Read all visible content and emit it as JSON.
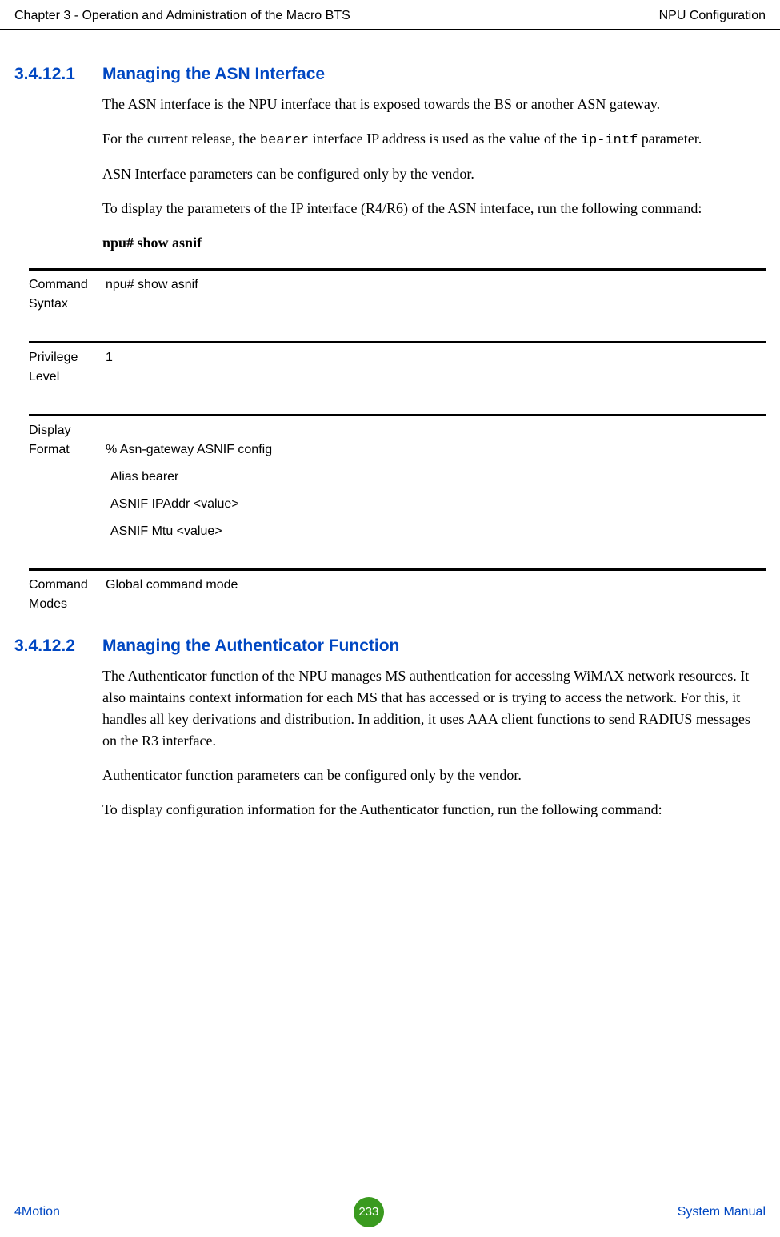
{
  "header": {
    "left": "Chapter 3 - Operation and Administration of the Macro BTS",
    "right": "NPU Configuration"
  },
  "section1": {
    "num": "3.4.12.1",
    "title": "Managing the ASN Interface",
    "p1a": "The ASN interface is the NPU interface that is exposed towards the BS or another ASN gateway.",
    "p2_prefix": "For the current release, the ",
    "p2_code1": "bearer",
    "p2_mid": " interface IP address is used as the value of the ",
    "p2_code2": "ip-intf",
    "p2_suffix": " parameter.",
    "p3": "ASN Interface parameters can be configured only by the vendor.",
    "p4": "To display the parameters of the IP interface (R4/R6) of the ASN interface, run the following command:",
    "cmd": "npu# show asnif"
  },
  "defs": {
    "syntax_label": "Command Syntax",
    "syntax_value": "npu# show asnif",
    "priv_label": "Privilege Level",
    "priv_value": "1",
    "display_label": "Display Format",
    "display_lines": {
      "l1": "% Asn-gateway ASNIF config",
      "l2": "Alias bearer",
      "l3": "ASNIF IPAddr <value>",
      "l4": "ASNIF Mtu <value>"
    },
    "modes_label": "Command Modes",
    "modes_value": "Global command mode"
  },
  "section2": {
    "num": "3.4.12.2",
    "title": "Managing the Authenticator Function",
    "p1": "The Authenticator function of the NPU manages MS authentication for accessing WiMAX network resources. It also maintains context information for each MS that has accessed or is trying to access the network. For this, it handles all key derivations and distribution. In addition, it uses AAA client functions to send RADIUS messages on the R3 interface.",
    "p2": "Authenticator function parameters can be configured only by the vendor.",
    "p3": "To display configuration information for the Authenticator function, run the following command:"
  },
  "footer": {
    "left": "4Motion",
    "page": "233",
    "right": "System Manual"
  }
}
